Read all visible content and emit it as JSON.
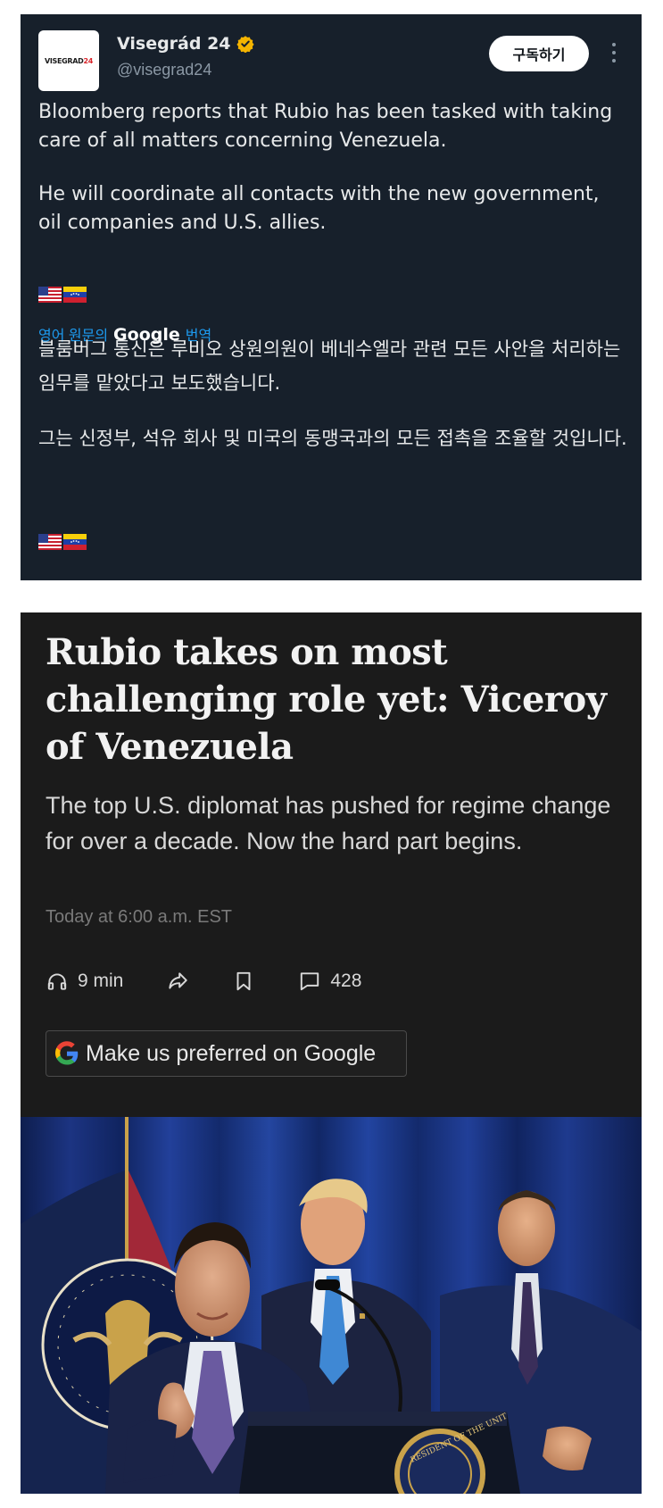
{
  "tweet": {
    "avatar_text": "VISEGRAD",
    "avatar_accent": "24",
    "display_name": "Visegrád 24",
    "handle": "@visegrad24",
    "subscribe_label": "구독하기",
    "paragraph_1": "Bloomberg reports that Rubio has been tasked with taking care of all matters concerning Venezuela.",
    "paragraph_2": "He will coordinate all contacts with the new government, oil companies and U.S. allies.",
    "flags": [
      "us-flag",
      "venezuela-flag"
    ],
    "translate_prefix": "영어 원문의",
    "translate_brand": "Google",
    "translate_suffix": "번역",
    "kr_paragraph_1": "블룸버그 통신은 루비오 상원의원이 베네수엘라 관련 모든 사안을 처리하는 임무를 맡았다고 보도했습니다.",
    "kr_paragraph_2": "그는 신정부, 석유 회사 및 미국의 동맹국과의 모든 접촉을 조율할 것입니다.",
    "colors": {
      "background": "#17202b",
      "link": "#1d9bf0",
      "verified": "#f4b400"
    }
  },
  "article": {
    "headline": "Rubio takes on most challenging role yet: Viceroy of Venezuela",
    "dek": "The top U.S. diplomat has pushed for regime change for over a decade. Now the hard part begins.",
    "timestamp": "Today at 6:00 a.m. EST",
    "listen_label": "9 min",
    "comment_count": "428",
    "icons": [
      "headphones-icon",
      "share-icon",
      "bookmark-icon",
      "comment-icon"
    ],
    "google_pref_label": "Make us preferred on Google",
    "colors": {
      "background": "#1b1b1b"
    }
  },
  "photo": {
    "seal_text": "RESIDENT OF THE UNIT"
  }
}
